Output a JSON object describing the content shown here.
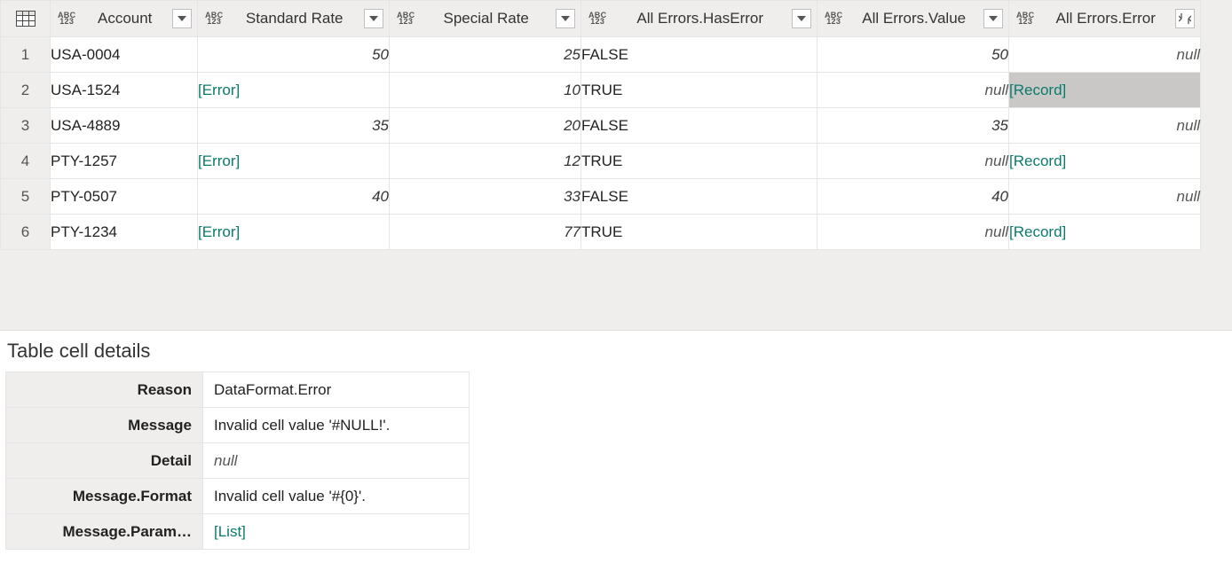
{
  "columns": [
    {
      "label": "Account",
      "button": "dropdown"
    },
    {
      "label": "Standard Rate",
      "button": "dropdown"
    },
    {
      "label": "Special Rate",
      "button": "dropdown"
    },
    {
      "label": "All Errors.HasError",
      "button": "dropdown"
    },
    {
      "label": "All Errors.Value",
      "button": "dropdown"
    },
    {
      "label": "All Errors.Error",
      "button": "expand"
    }
  ],
  "rows": [
    {
      "n": "1",
      "account": "USA-0004",
      "std": "50",
      "std_type": "num",
      "spec": "25",
      "has": "FALSE",
      "val": "50",
      "val_type": "num",
      "err": "null",
      "err_type": "null"
    },
    {
      "n": "2",
      "account": "USA-1524",
      "std": "[Error]",
      "std_type": "error",
      "spec": "10",
      "has": "TRUE",
      "val": "null",
      "val_type": "null",
      "err": "[Record]",
      "err_type": "link",
      "err_selected": true
    },
    {
      "n": "3",
      "account": "USA-4889",
      "std": "35",
      "std_type": "num",
      "spec": "20",
      "has": "FALSE",
      "val": "35",
      "val_type": "num",
      "err": "null",
      "err_type": "null"
    },
    {
      "n": "4",
      "account": "PTY-1257",
      "std": "[Error]",
      "std_type": "error",
      "spec": "12",
      "has": "TRUE",
      "val": "null",
      "val_type": "null",
      "err": "[Record]",
      "err_type": "link"
    },
    {
      "n": "5",
      "account": "PTY-0507",
      "std": "40",
      "std_type": "num",
      "spec": "33",
      "has": "FALSE",
      "val": "40",
      "val_type": "num",
      "err": "null",
      "err_type": "null"
    },
    {
      "n": "6",
      "account": "PTY-1234",
      "std": "[Error]",
      "std_type": "error",
      "spec": "77",
      "has": "TRUE",
      "val": "null",
      "val_type": "null",
      "err": "[Record]",
      "err_type": "link"
    }
  ],
  "details": {
    "title": "Table cell details",
    "items": [
      {
        "key": "Reason",
        "value": "DataFormat.Error",
        "type": "txt"
      },
      {
        "key": "Message",
        "value": "Invalid cell value '#NULL!'.",
        "type": "txt"
      },
      {
        "key": "Detail",
        "value": "null",
        "type": "null"
      },
      {
        "key": "Message.Format",
        "value": "Invalid cell value '#{0}'.",
        "type": "txt"
      },
      {
        "key": "Message.Param…",
        "value": "[List]",
        "type": "link"
      }
    ]
  }
}
